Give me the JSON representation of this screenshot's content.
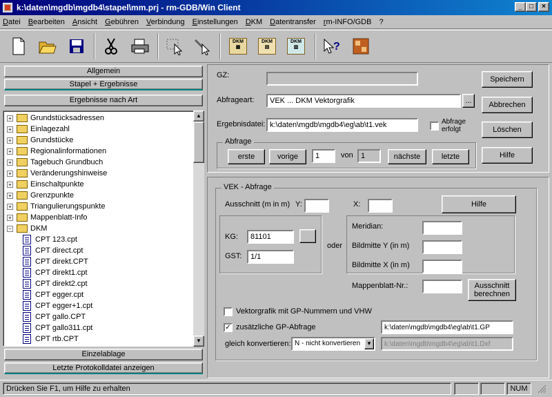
{
  "window": {
    "title": "k:\\daten\\mgdb\\mgdb4\\stapel\\mm.prj - rm-GDB/Win Client",
    "min": "_",
    "max": "□",
    "close": "×"
  },
  "menu": [
    "Datei",
    "Bearbeiten",
    "Ansicht",
    "Gebühren",
    "Verbindung",
    "Einstellungen",
    "DKM",
    "Datentransfer",
    "rm-INFO/GDB",
    "?"
  ],
  "toolbar": {
    "icons": [
      "new-file-icon",
      "open-folder-icon",
      "save-disk-icon",
      "cut-scissors-icon",
      "print-icon",
      "select-tool-icon",
      "info-tool-icon",
      "dkm-1-icon",
      "dkm-2-icon",
      "dkm-3-icon",
      "help-cursor-icon",
      "gis-icon"
    ],
    "dkm_label": "DKM"
  },
  "left": {
    "btn_allgemein": "Allgemein",
    "btn_stapel": "Stapel + Ergebnisse",
    "btn_ergebnisse": "Ergebnisse nach Art",
    "btn_einzelablage": "Einzelablage",
    "btn_protokoll": "Letzte Protokolldatei anzeigen",
    "tree": [
      {
        "label": "Grundstücksadressen",
        "type": "folder",
        "sign": "+"
      },
      {
        "label": "Einlagezahl",
        "type": "folder",
        "sign": "+"
      },
      {
        "label": "Grundstücke",
        "type": "folder",
        "sign": "+"
      },
      {
        "label": "Regionalinformationen",
        "type": "folder",
        "sign": "+"
      },
      {
        "label": "Tagebuch Grundbuch",
        "type": "folder",
        "sign": "+"
      },
      {
        "label": "Veränderungshinweise",
        "type": "folder",
        "sign": "+"
      },
      {
        "label": "Einschaltpunkte",
        "type": "folder",
        "sign": "+"
      },
      {
        "label": "Grenzpunkte",
        "type": "folder",
        "sign": "+"
      },
      {
        "label": "Triangulierungspunkte",
        "type": "folder",
        "sign": "+"
      },
      {
        "label": "Mappenblatt-Info",
        "type": "folder",
        "sign": "+"
      },
      {
        "label": "DKM",
        "type": "folder",
        "sign": "−"
      },
      {
        "label": "CPT 123.cpt",
        "type": "doc"
      },
      {
        "label": "CPT direct.cpt",
        "type": "doc"
      },
      {
        "label": "CPT direkt.CPT",
        "type": "doc"
      },
      {
        "label": "CPT direkt1.cpt",
        "type": "doc"
      },
      {
        "label": "CPT direkt2.cpt",
        "type": "doc"
      },
      {
        "label": "CPT egger.cpt",
        "type": "doc"
      },
      {
        "label": "CPT egger+1.cpt",
        "type": "doc"
      },
      {
        "label": "CPT gallo.CPT",
        "type": "doc"
      },
      {
        "label": "CPT gallo311.cpt",
        "type": "doc"
      },
      {
        "label": "CPT rtb.CPT",
        "type": "doc"
      }
    ]
  },
  "top": {
    "gz_label": "GZ:",
    "gz_value": "",
    "abfrageart_label": "Abfrageart:",
    "abfrageart_value": "VEK ... DKM Vektorgrafik",
    "ergebnisdatei_label": "Ergebnisdatei:",
    "ergebnisdatei_value": "k:\\daten\\mgdb\\mgdb4\\eg\\ab\\t1.vek",
    "abfrage_erfolgt": "Abfrage erfolgt",
    "browse": "...",
    "abfrage_group": "Abfrage",
    "erste": "erste",
    "vorige": "vorige",
    "current": "1",
    "von": "von",
    "total": "1",
    "naechste": "nächste",
    "letzte": "letzte",
    "speichern": "Speichern",
    "abbrechen": "Abbrechen",
    "loeschen": "Löschen",
    "hilfe": "Hilfe"
  },
  "vek": {
    "group": "VEK - Abfrage",
    "ausschnitt_label": "Ausschnitt (m in m)",
    "y_label": "Y:",
    "y_value": "",
    "x_label": "X:",
    "x_value": "",
    "hilfe": "Hilfe",
    "kg_label": "KG:",
    "kg_value": "81101",
    "gst_label": "GST:",
    "gst_value": "1/1",
    "oder": "oder",
    "meridian_label": "Meridian:",
    "bildmitte_y_label": "Bildmitte Y (in m)",
    "bildmitte_x_label": "Bildmitte X (in m)",
    "mappenblatt_label": "Mappenblatt-Nr.:",
    "ausschnitt_berechnen": "Ausschnitt berechnen",
    "vektorgrafik_gp": "Vektorgrafik mit GP-Nummern und VHW",
    "zusaetzliche_gp": "zusätzliche GP-Abfrage",
    "gp_path": "k:\\daten\\mgdb\\mgdb4\\eg\\ab\\t1.GP",
    "gleich_konvertieren": "gleich konvertieren:",
    "konvertieren_value": "N - nicht konvertieren",
    "conv_path": "k:\\daten\\mgdb\\mgdb4\\eg\\ab\\t1.Dxf"
  },
  "status": {
    "text": "Drücken Sie F1, um Hilfe zu erhalten",
    "num": "NUM"
  }
}
